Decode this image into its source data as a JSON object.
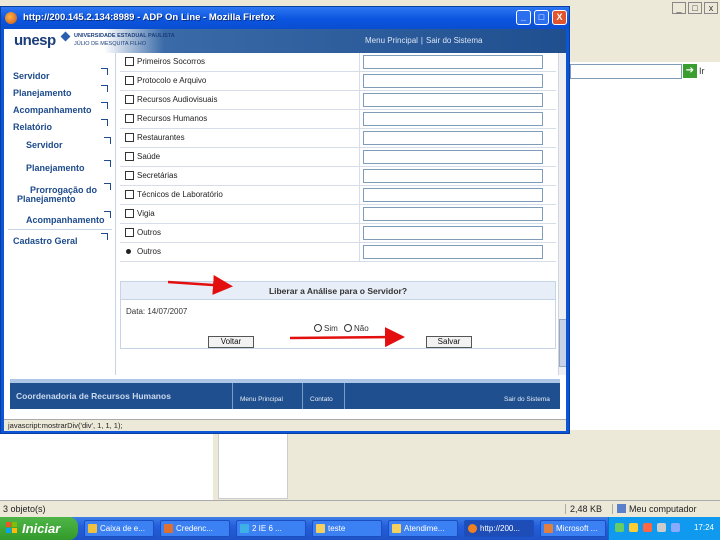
{
  "popup": {
    "title": "http://200.145.2.134:8989 - ADP On Line - Mozilla Firefox",
    "minimize_glyph": "_",
    "maximize_glyph": "□",
    "close_glyph": "X"
  },
  "header": {
    "logo": "unesp",
    "logo_sub1": "UNIVERSIDADE ESTADUAL PAULISTA",
    "logo_sub2": "JÚLIO DE MESQUITA FILHO",
    "menu_principal": "Menu Principal",
    "separator": "|",
    "sair": "Sair do Sistema"
  },
  "sidebar": {
    "items": [
      {
        "label": "Servidor"
      },
      {
        "label": "Planejamento"
      },
      {
        "label": "Acompanhamento"
      },
      {
        "label": "Relatório"
      },
      {
        "label": "Servidor"
      },
      {
        "label": "Planejamento"
      },
      {
        "label": "Prorrogação do"
      },
      {
        "label": "Planejamento"
      },
      {
        "label": "Acompanhamento"
      },
      {
        "label": "Cadastro Geral"
      }
    ]
  },
  "form": {
    "rows": [
      {
        "label": "Primeiros Socorros",
        "type": "checkbox"
      },
      {
        "label": "Protocolo e Arquivo",
        "type": "checkbox"
      },
      {
        "label": "Recursos Audiovisuais",
        "type": "checkbox"
      },
      {
        "label": "Recursos Humanos",
        "type": "checkbox"
      },
      {
        "label": "Restaurantes",
        "type": "checkbox"
      },
      {
        "label": "Saúde",
        "type": "checkbox"
      },
      {
        "label": "Secretárias",
        "type": "checkbox"
      },
      {
        "label": "Técnicos de Laboratório",
        "type": "checkbox"
      },
      {
        "label": "Vigia",
        "type": "checkbox"
      },
      {
        "label": "Outros",
        "type": "checkbox"
      },
      {
        "label": "Outros",
        "type": "radio"
      }
    ]
  },
  "libera": {
    "title": "Liberar a Análise para o Servidor?",
    "date": "Data: 14/07/2007",
    "option_sim": "Sim",
    "option_nao": "Não",
    "voltar": "Voltar",
    "salvar": "Salvar"
  },
  "footer": {
    "left": "Coordenadoria de Recursos Humanos",
    "menu_principal": "Menu Principal",
    "contato": "Contato",
    "sair": "Sair do Sistema"
  },
  "window_status": "javascript:mostrarDiv('div', 1, 1, 1);",
  "background": {
    "go_label": "Ir",
    "status_left": "3 objeto(s)",
    "status_size": "2,48 KB",
    "status_zone": "Meu computador"
  },
  "taskbar": {
    "start": "Iniciar",
    "items": [
      "Caixa de e...",
      "Credenc...",
      "2 IE 6 ...",
      "teste",
      "Atendime...",
      "http://200...",
      "Microsoft ..."
    ],
    "clock": "17:24"
  },
  "colors": {
    "accent": "#1d4b8c",
    "arrow": "#e30f0f",
    "title_blue": "#0b55e0"
  }
}
